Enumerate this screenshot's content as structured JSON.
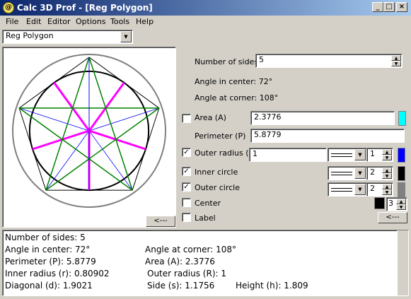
{
  "window": {
    "title": "Calc 3D Prof - [Reg Polygon]",
    "icon": "calc-3d-app-icon",
    "controls": [
      "_",
      "□",
      "×"
    ]
  },
  "menu": [
    "File",
    "Edit",
    "Editor",
    "Options",
    "Tools",
    "Help"
  ],
  "object_selector": {
    "value": "Reg Polygon"
  },
  "drawing": {
    "sides": 5,
    "colors": {
      "outer_circle": "#808080",
      "inner_circle": "#000000",
      "outer_radius_lines": "#0000ff",
      "inner_radius_lines": "#ff00ff",
      "diagonals": "#008000",
      "polygon": "#000000"
    },
    "back_button": "<---"
  },
  "form": {
    "sides_label": "Number of sides",
    "sides_value": "5",
    "angle_center_text": "Angle in center: 72°",
    "angle_corner_text": "Angle at corner: 108°",
    "area_label": "Area (A)",
    "area_value": "2.3776",
    "area_checked": false,
    "area_color": "#00ffff",
    "perimeter_label": "Perimeter (P)",
    "perimeter_value": "5.8779",
    "outer_radius_label": "Outer radius (R)",
    "outer_radius_value": "1",
    "outer_radius_checked": true,
    "outer_radius_width": "1",
    "outer_radius_color": "#0000ff",
    "inner_circle_label": "Inner circle",
    "inner_circle_checked": true,
    "inner_circle_width": "2",
    "inner_circle_color": "#000000",
    "outer_circle_label": "Outer circle",
    "outer_circle_checked": true,
    "outer_circle_width": "2",
    "outer_circle_color": "#808080",
    "center_label": "Center",
    "center_checked": false,
    "center_size": "3",
    "center_color": "#000000",
    "label_label": "Label",
    "label_checked": false,
    "back_button": "<---"
  },
  "output": {
    "line1": "Number of sides: 5",
    "line2a": "Angle in center: 72°",
    "line2b": "Angle at corner: 108°",
    "line3a": "Perimeter (P): 5.8779",
    "line3b": "Area (A): 2.3776",
    "line4a": "Inner radius (r): 0.80902",
    "line4b": "Outer radius (R): 1",
    "line5a": "Diagonal (d): 1.9021",
    "line5b": "Side (s): 1.1756",
    "line5c": "Height (h): 1.809"
  }
}
